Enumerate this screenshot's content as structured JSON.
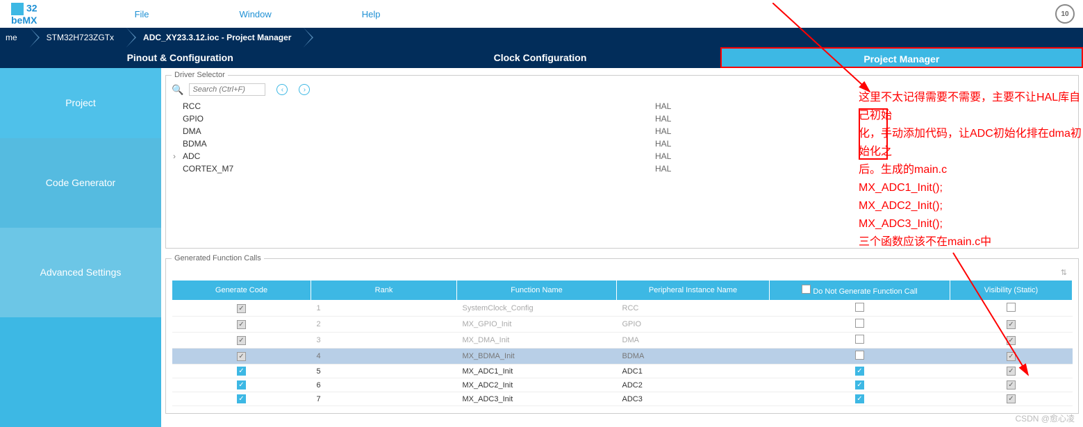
{
  "menu": {
    "file": "File",
    "window": "Window",
    "help": "Help",
    "logo_top": "32",
    "logo_bot": "beMX",
    "badge": "10"
  },
  "breadcrumb": {
    "me": "me",
    "chip": "STM32H723ZGTx",
    "proj": "ADC_XY23.3.12.ioc - Project Manager"
  },
  "tabs": {
    "pinout": "Pinout & Configuration",
    "clock": "Clock Configuration",
    "pm": "Project Manager"
  },
  "sidebar": {
    "project": "Project",
    "code": "Code Generator",
    "adv": "Advanced Settings"
  },
  "driver": {
    "legend": "Driver Selector",
    "placeholder": "Search (Ctrl+F)",
    "rows": [
      {
        "name": "RCC",
        "val": "HAL"
      },
      {
        "name": "GPIO",
        "val": "HAL"
      },
      {
        "name": "DMA",
        "val": "HAL"
      },
      {
        "name": "BDMA",
        "val": "HAL"
      },
      {
        "name": "ADC",
        "val": "HAL",
        "expand": true
      },
      {
        "name": "CORTEX_M7",
        "val": "HAL"
      }
    ]
  },
  "annotation": {
    "l1": "这里不太记得需要不需要，主要不让HAL库自己初始",
    "l2": "化，手动添加代码，让ADC初始化排在dma初始化之",
    "l3": "后。生成的main.c",
    "l4": " MX_ADC1_Init();",
    "l5": " MX_ADC2_Init();",
    "l6": "MX_ADC3_Init();",
    "l7": "三个函数应该不在main.c中"
  },
  "gen": {
    "legend": "Generated Function Calls",
    "headers": {
      "gen": "Generate Code",
      "rank": "Rank",
      "fn": "Function Name",
      "pin": "Peripheral Instance Name",
      "dn": "Do Not Generate Function Call",
      "vis": "Visibility (Static)"
    },
    "rows": [
      {
        "gen": "g",
        "rank": "1",
        "fn": "SystemClock_Config",
        "pin": "RCC",
        "dn": "off",
        "vis": "off",
        "cls": "disabled"
      },
      {
        "gen": "g",
        "rank": "2",
        "fn": "MX_GPIO_Init",
        "pin": "GPIO",
        "dn": "off",
        "vis": "g",
        "cls": "disabled"
      },
      {
        "gen": "g",
        "rank": "3",
        "fn": "MX_DMA_Init",
        "pin": "DMA",
        "dn": "off",
        "vis": "g",
        "cls": "disabled"
      },
      {
        "gen": "g",
        "rank": "4",
        "fn": "MX_BDMA_Init",
        "pin": "BDMA",
        "dn": "off",
        "vis": "g",
        "cls": "sel"
      },
      {
        "gen": "on",
        "rank": "5",
        "fn": "MX_ADC1_Init",
        "pin": "ADC1",
        "dn": "on",
        "vis": "g",
        "cls": "enabled"
      },
      {
        "gen": "on",
        "rank": "6",
        "fn": "MX_ADC2_Init",
        "pin": "ADC2",
        "dn": "on",
        "vis": "g",
        "cls": "enabled"
      },
      {
        "gen": "on",
        "rank": "7",
        "fn": "MX_ADC3_Init",
        "pin": "ADC3",
        "dn": "on",
        "vis": "g",
        "cls": "enabled"
      }
    ]
  },
  "watermark": "CSDN @愈心凌"
}
